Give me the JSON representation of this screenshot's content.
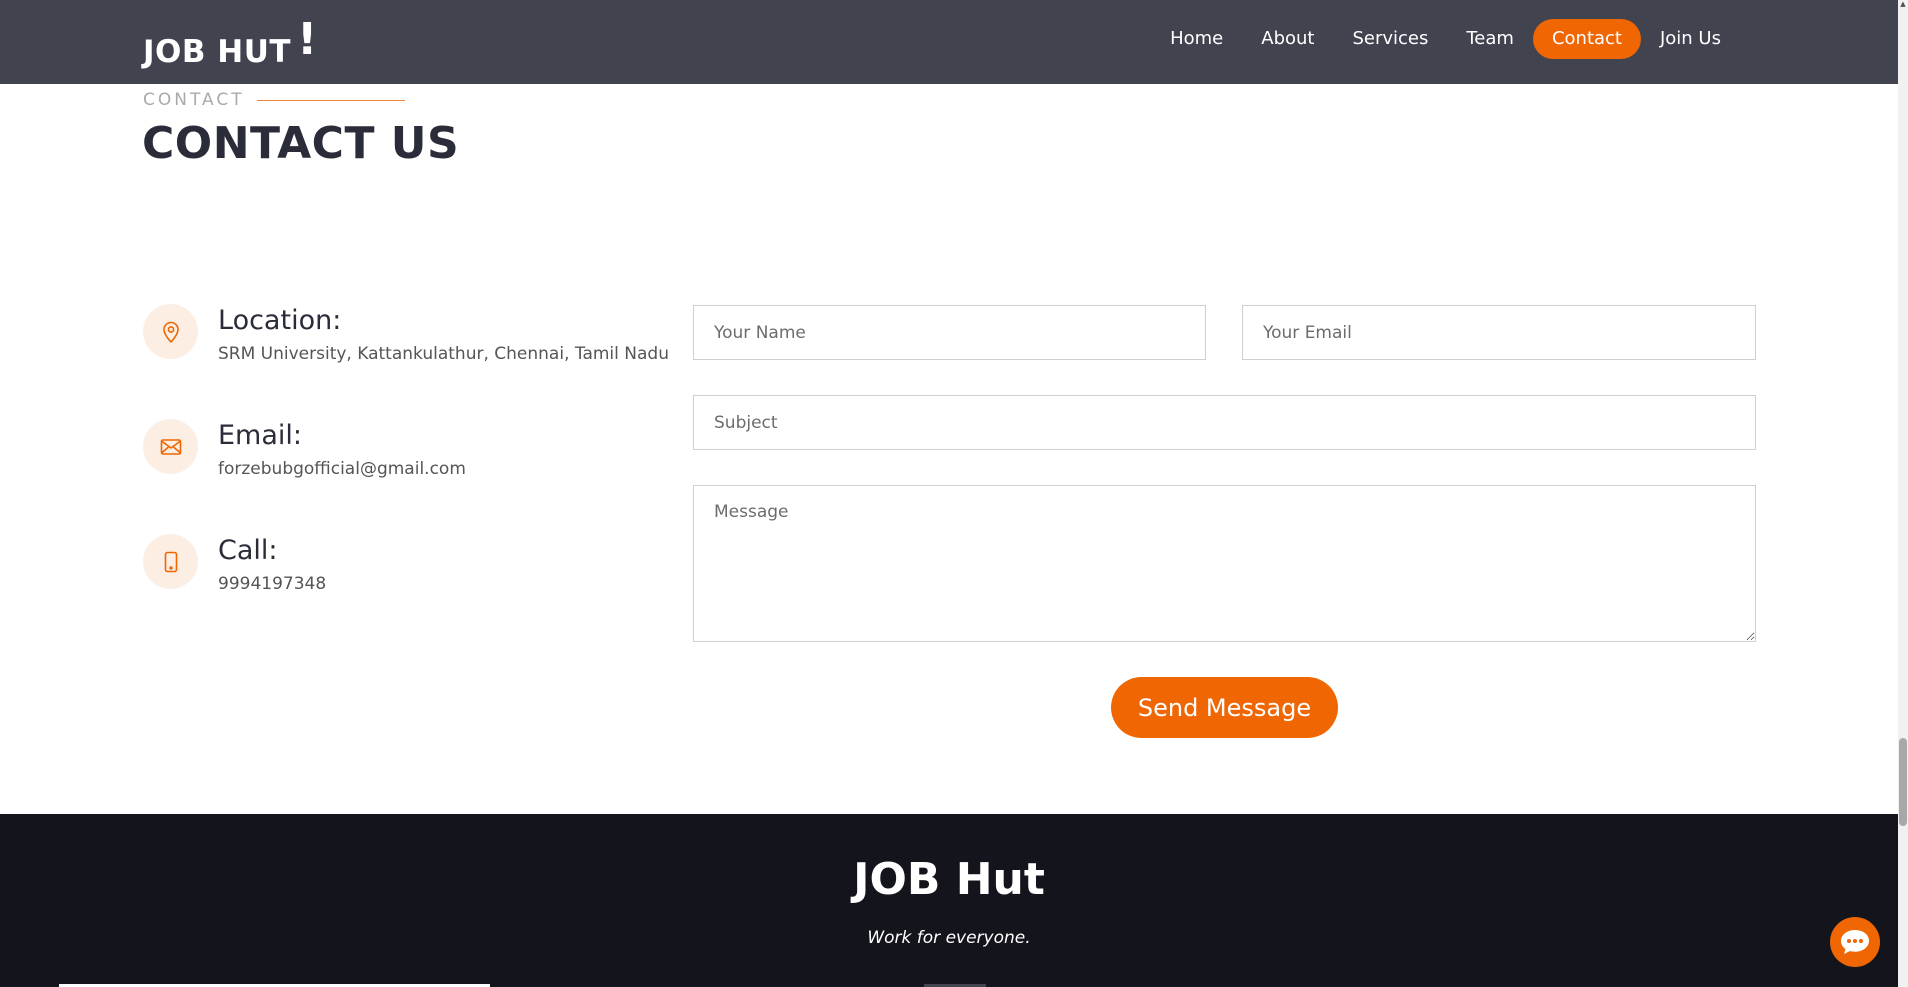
{
  "header": {
    "logo": "JOB HUT",
    "logo_mark": "!",
    "nav": [
      "Home",
      "About",
      "Services",
      "Team",
      "Contact",
      "Join Us"
    ],
    "active_nav": "Contact"
  },
  "section": {
    "subtitle": "CONTACT",
    "title": "CONTACT US"
  },
  "info": {
    "location": {
      "icon": "map-pin-icon",
      "title": "Location:",
      "value": "SRM University, Kattankulathur, Chennai, Tamil Nadu"
    },
    "email": {
      "icon": "envelope-icon",
      "title": "Email:",
      "value": "forzebubgofficial@gmail.com"
    },
    "call": {
      "icon": "phone-icon",
      "title": "Call:",
      "value": "9994197348"
    }
  },
  "form": {
    "name_placeholder": "Your Name",
    "email_placeholder": "Your Email",
    "subject_placeholder": "Subject",
    "message_placeholder": "Message",
    "submit_label": "Send Message"
  },
  "footer": {
    "title": "JOB Hut",
    "tagline": "Work for everyone."
  },
  "colors": {
    "accent": "#ef6603",
    "header_bg": "#41434f",
    "footer_bg": "#14141d",
    "icon_bg": "#fdeee3",
    "heading": "#2a2c39"
  }
}
